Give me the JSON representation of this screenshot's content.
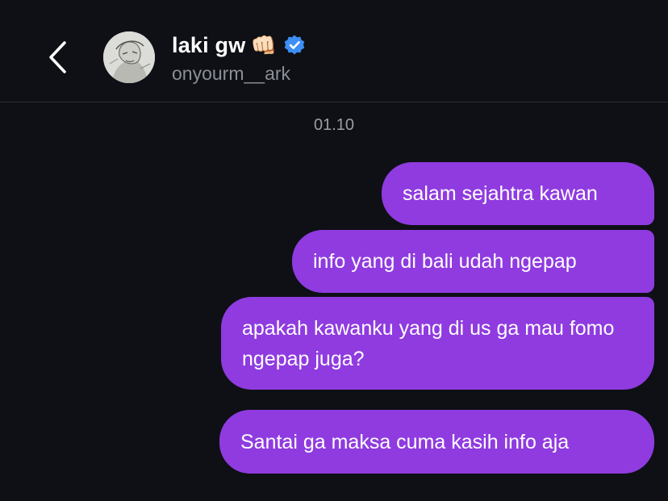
{
  "header": {
    "display_name": "laki gw",
    "display_emoji": "👊🏻",
    "username": "onyourm__ark",
    "verified": true,
    "back_icon": "chevron-left-icon",
    "verified_icon": "verified-badge-icon"
  },
  "chat": {
    "timestamp": "01.10",
    "messages": [
      {
        "text": "salam sejahtra kawan",
        "sender": "me"
      },
      {
        "text": "info yang di bali udah ngepap",
        "sender": "me"
      },
      {
        "text": "apakah kawanku yang di us ga mau fomo ngepap juga?",
        "sender": "me"
      },
      {
        "text": "Santai ga maksa cuma kasih info aja",
        "sender": "me"
      }
    ]
  },
  "colors": {
    "background": "#0e1015",
    "bubble": "#8f3be0",
    "verified": "#3d8ef5",
    "muted_text": "#8b8f96"
  }
}
